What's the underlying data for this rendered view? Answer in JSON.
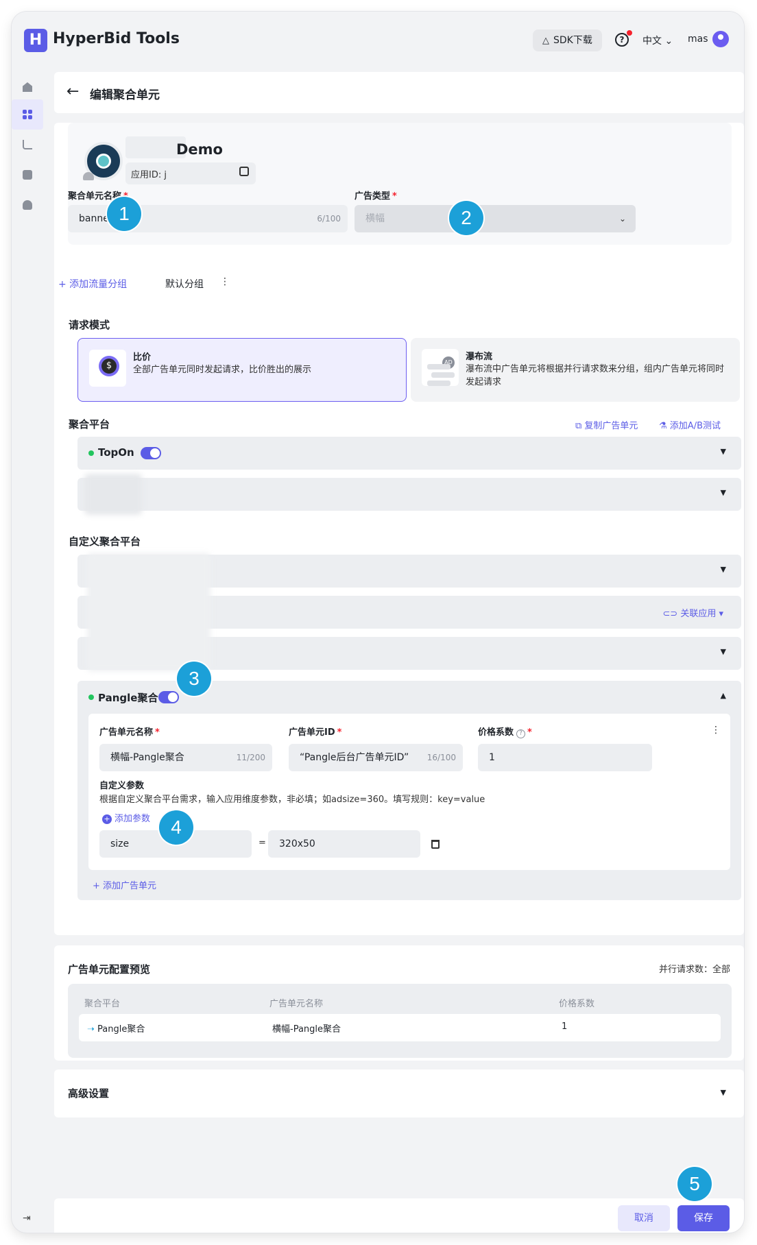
{
  "app": {
    "name": "HyperBid Tools",
    "logo_letter": "H"
  },
  "topbar": {
    "sdk_label": "SDK下载",
    "help_label": "?",
    "language": "中文 ⌄",
    "user": "mas"
  },
  "header": {
    "title": "编辑聚合单元"
  },
  "app_info": {
    "name": "Demo",
    "id_label": "应用ID: j"
  },
  "form": {
    "unit_name_label": "聚合单元名称",
    "unit_name_value": "banner",
    "unit_name_count": "6/100",
    "ad_type_label": "广告类型",
    "ad_type_value": "横幅",
    "required_mark": "*"
  },
  "tabs": {
    "add_group": "+ 添加流量分组",
    "default_group": "默认分组",
    "more": "⋮"
  },
  "request_mode": {
    "title": "请求模式",
    "bid_name": "比价",
    "bid_desc": "全部广告单元同时发起请求，比价胜出的展示",
    "waterfall_name": "瀑布流",
    "waterfall_desc": "瀑布流中广告单元将根据并行请求数来分组，组内广告单元将同时发起请求"
  },
  "platforms": {
    "title": "聚合平台",
    "copy_unit": "复制广告单元",
    "add_ab": "添加A/B测试",
    "topon_name": "TopOn",
    "custom_title": "自定义聚合平台",
    "link_app": "关联应用"
  },
  "pangle": {
    "name": "Pangle聚合",
    "unit_name_label": "广告单元名称",
    "unit_name_value": "横幅-Pangle聚合",
    "unit_name_count": "11/200",
    "unit_id_label": "广告单元ID",
    "unit_id_value": "“Pangle后台广告单元ID”",
    "unit_id_count": "16/100",
    "price_label": "价格系数",
    "price_value": "1",
    "custom_params_label": "自定义参数",
    "custom_params_hint": "根据自定义聚合平台需求，输入应用维度参数，非必填；如adsize=360。填写规则：key=value",
    "add_param": "添加参数",
    "param_key": "size",
    "param_eq": "=",
    "param_value": "320x50",
    "add_unit": "+ 添加广告单元"
  },
  "preview": {
    "title": "广告单元配置预览",
    "parallel": "并行请求数：全部",
    "headers": [
      "聚合平台",
      "广告单元名称",
      "价格系数"
    ],
    "rows": [
      [
        "Pangle聚合",
        "横幅-Pangle聚合",
        "1"
      ]
    ]
  },
  "advanced": {
    "title": "高级设置"
  },
  "footer": {
    "cancel": "取消",
    "save": "保存"
  },
  "annotations": [
    "1",
    "2",
    "3",
    "4",
    "5"
  ],
  "colors": {
    "accent": "#5b5ce6",
    "badge": "#1ca0d8",
    "success": "#22c55e",
    "required": "#f5222d"
  }
}
